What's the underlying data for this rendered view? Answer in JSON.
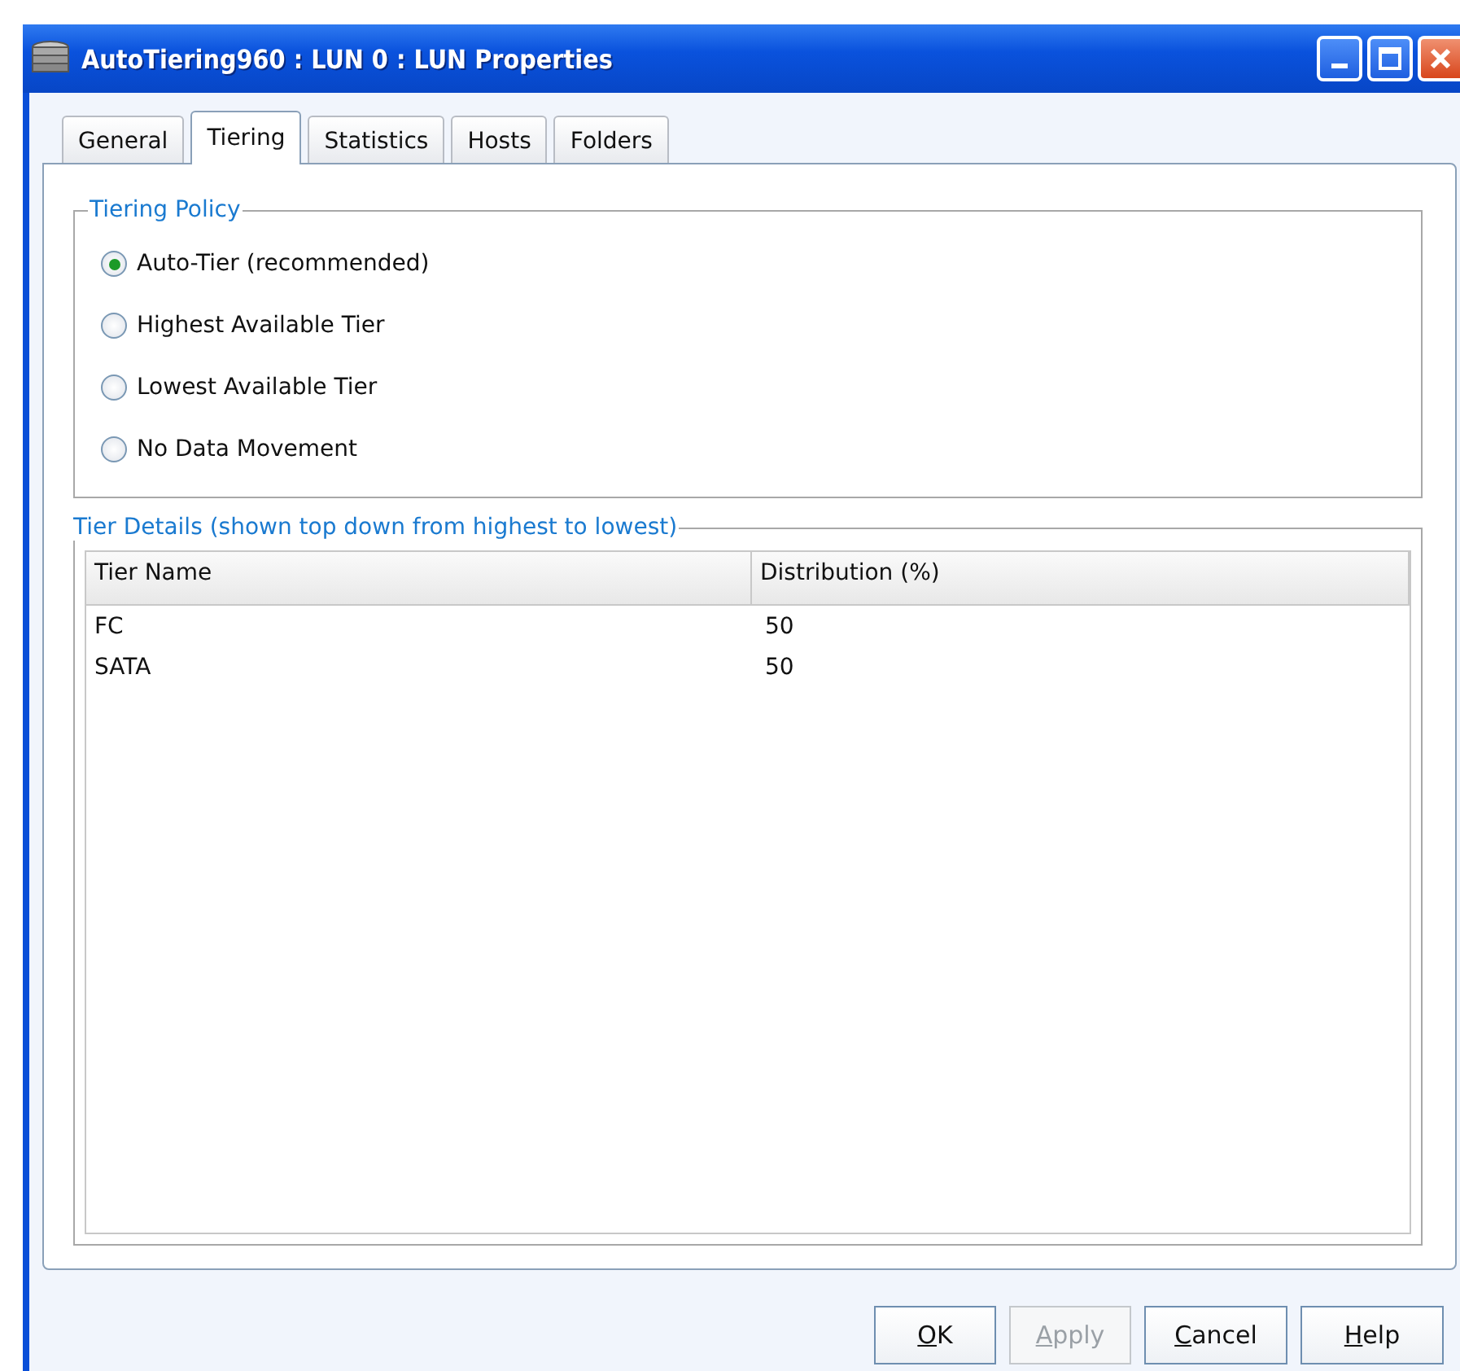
{
  "window": {
    "title": "AutoTiering960 : LUN 0 : LUN Properties"
  },
  "tabs": [
    {
      "label": "General",
      "selected": false
    },
    {
      "label": "Tiering",
      "selected": true
    },
    {
      "label": "Statistics",
      "selected": false
    },
    {
      "label": "Hosts",
      "selected": false
    },
    {
      "label": "Folders",
      "selected": false
    }
  ],
  "tiering_policy": {
    "title": "Tiering Policy",
    "options": [
      {
        "label": "Auto-Tier (recommended)",
        "selected": true
      },
      {
        "label": "Highest Available Tier",
        "selected": false
      },
      {
        "label": "Lowest Available Tier",
        "selected": false
      },
      {
        "label": "No Data Movement",
        "selected": false
      }
    ]
  },
  "tier_details": {
    "title": "Tier Details (shown top down from highest to lowest)",
    "table": {
      "columns": [
        "Tier Name",
        "Distribution (%)"
      ],
      "rows": [
        [
          "FC",
          "50"
        ],
        [
          "SATA",
          "50"
        ]
      ]
    }
  },
  "buttons": [
    {
      "label": "OK",
      "disabled": false,
      "underline_first": true
    },
    {
      "label": "Apply",
      "disabled": true,
      "underline_first": true
    },
    {
      "label": "Cancel",
      "disabled": false,
      "underline_first": true
    },
    {
      "label": "Help",
      "disabled": false,
      "underline_first": true
    }
  ]
}
